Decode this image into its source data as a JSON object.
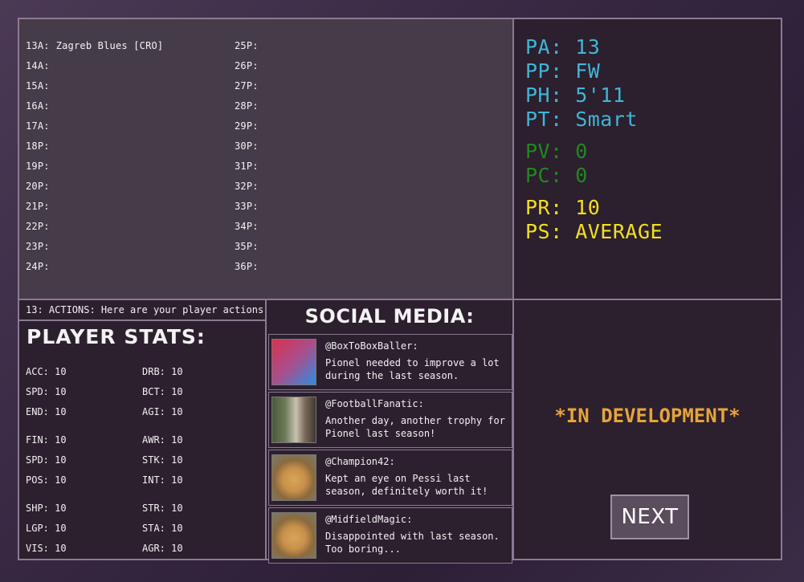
{
  "history": {
    "left": [
      {
        "label": "13A:",
        "value": "Zagreb Blues [CRO]"
      },
      {
        "label": "14A:",
        "value": ""
      },
      {
        "label": "15A:",
        "value": ""
      },
      {
        "label": "16A:",
        "value": ""
      },
      {
        "label": "17A:",
        "value": ""
      },
      {
        "label": "18P:",
        "value": ""
      },
      {
        "label": "19P:",
        "value": ""
      },
      {
        "label": "20P:",
        "value": ""
      },
      {
        "label": "21P:",
        "value": ""
      },
      {
        "label": "22P:",
        "value": ""
      },
      {
        "label": "23P:",
        "value": ""
      },
      {
        "label": "24P:",
        "value": ""
      }
    ],
    "right": [
      {
        "label": "25P:",
        "value": ""
      },
      {
        "label": "26P:",
        "value": ""
      },
      {
        "label": "27P:",
        "value": ""
      },
      {
        "label": "28P:",
        "value": ""
      },
      {
        "label": "29P:",
        "value": ""
      },
      {
        "label": "30P:",
        "value": ""
      },
      {
        "label": "31P:",
        "value": ""
      },
      {
        "label": "32P:",
        "value": ""
      },
      {
        "label": "33P:",
        "value": ""
      },
      {
        "label": "34P:",
        "value": ""
      },
      {
        "label": "35P:",
        "value": ""
      },
      {
        "label": "36P:",
        "value": ""
      }
    ]
  },
  "profile": {
    "pa": "PA: 13",
    "pp": "PP: FW",
    "ph": "PH: 5'11",
    "pt": "PT: Smart",
    "pv": "PV: 0",
    "pc": "PC: 0",
    "pr": "PR: 10",
    "ps": "PS: AVERAGE",
    "colors": {
      "info": "#3fb6d6",
      "money": "#1f8a1f",
      "rating": "#f0e020"
    }
  },
  "actions": {
    "text": "13: ACTIONS: Here are your player actions:"
  },
  "stats": {
    "title": "PLAYER STATS:",
    "groups": [
      {
        "left": [
          "ACC: 10",
          "SPD: 10",
          "END: 10"
        ],
        "right": [
          "DRB: 10",
          "BCT: 10",
          "AGI: 10"
        ]
      },
      {
        "left": [
          "FIN: 10",
          "SPD: 10",
          "POS: 10"
        ],
        "right": [
          "AWR: 10",
          "STK: 10",
          "INT: 10"
        ]
      },
      {
        "left": [
          "SHP: 10",
          "LGP: 10",
          "VIS: 10"
        ],
        "right": [
          "STR: 10",
          "STA: 10",
          "AGR: 10"
        ]
      }
    ]
  },
  "social": {
    "title": "SOCIAL MEDIA:",
    "posts": [
      {
        "handle": "@BoxToBoxBaller:",
        "message": "Pionel needed to improve a lot during the last season.",
        "avatar": "gradient-avatar"
      },
      {
        "handle": "@FootballFanatic:",
        "message": "Another day, another trophy for Pionel last season!",
        "avatar": "photo-avatar"
      },
      {
        "handle": "@Champion42:",
        "message": "Kept an eye on Pessi last season, definitely worth it!",
        "avatar": "dog-avatar"
      },
      {
        "handle": "@MidfieldMagic:",
        "message": "Disappointed with last season. Too boring...",
        "avatar": "dog-avatar"
      }
    ]
  },
  "dev": {
    "text": "*IN DEVELOPMENT*",
    "next_label": "NEXT"
  }
}
